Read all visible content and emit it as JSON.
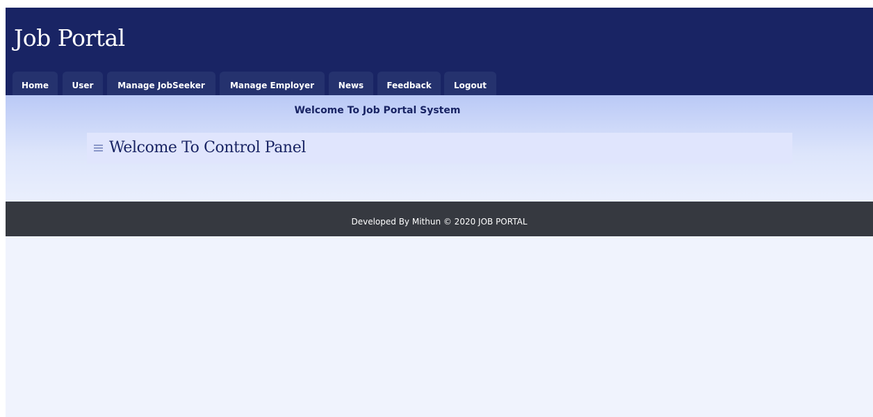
{
  "app": {
    "title": "Job Portal"
  },
  "nav": {
    "items": [
      {
        "label": "Home"
      },
      {
        "label": "User"
      },
      {
        "label": "Manage JobSeeker"
      },
      {
        "label": "Manage Employer"
      },
      {
        "label": "News"
      },
      {
        "label": "Feedback"
      },
      {
        "label": "Logout"
      }
    ]
  },
  "main": {
    "welcome_text": "Welcome To Job Portal System",
    "panel_icon": "menu-icon",
    "panel_title": "Welcome To Control Panel"
  },
  "footer": {
    "text": "Developed By Mithun © 2020 JOB PORTAL"
  },
  "colors": {
    "header_bg": "#192464",
    "tab_bg": "#25326e",
    "footer_bg": "#363940",
    "page_bg": "#f0f3fd",
    "panel_bg": "#e0e5fd"
  }
}
